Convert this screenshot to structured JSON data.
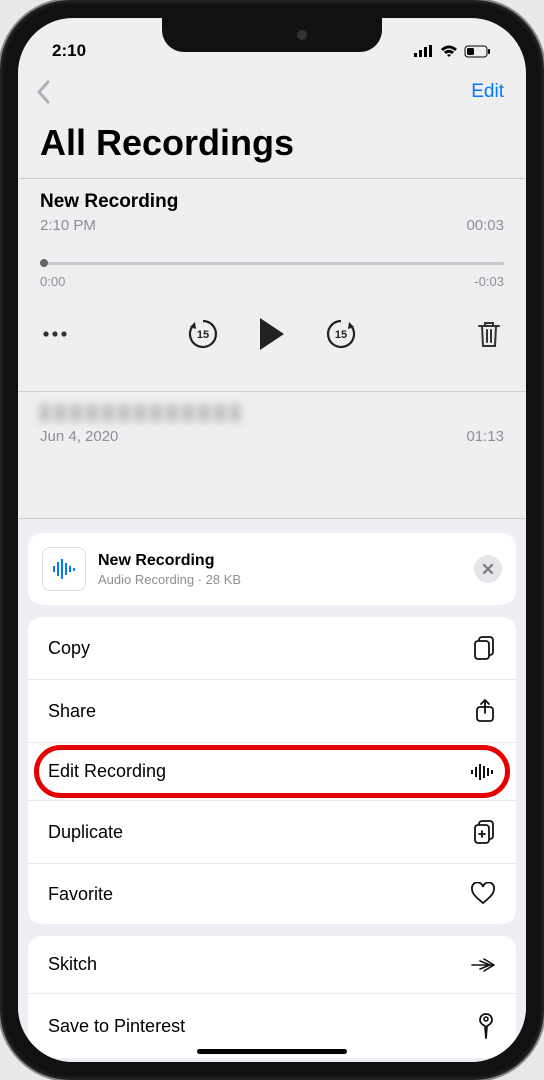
{
  "status": {
    "time": "2:10"
  },
  "nav": {
    "edit_label": "Edit"
  },
  "page": {
    "title": "All Recordings"
  },
  "current": {
    "title": "New Recording",
    "time": "2:10 PM",
    "duration": "00:03",
    "scrub_start": "0:00",
    "scrub_end": "-0:03"
  },
  "controls": {
    "skip_back": "15",
    "skip_fwd": "15"
  },
  "older": {
    "date": "Jun 4, 2020",
    "duration": "01:13"
  },
  "sheet": {
    "header": {
      "title": "New Recording",
      "subtitle": "Audio Recording · 28 KB"
    },
    "items": [
      {
        "label": "Copy",
        "icon": "copy"
      },
      {
        "label": "Share",
        "icon": "share"
      },
      {
        "label": "Edit Recording",
        "icon": "waveform",
        "highlighted": true
      },
      {
        "label": "Duplicate",
        "icon": "duplicate"
      },
      {
        "label": "Favorite",
        "icon": "heart"
      }
    ],
    "extra": [
      {
        "label": "Skitch",
        "icon": "feather"
      },
      {
        "label": "Save to Pinterest",
        "icon": "pin"
      }
    ]
  }
}
